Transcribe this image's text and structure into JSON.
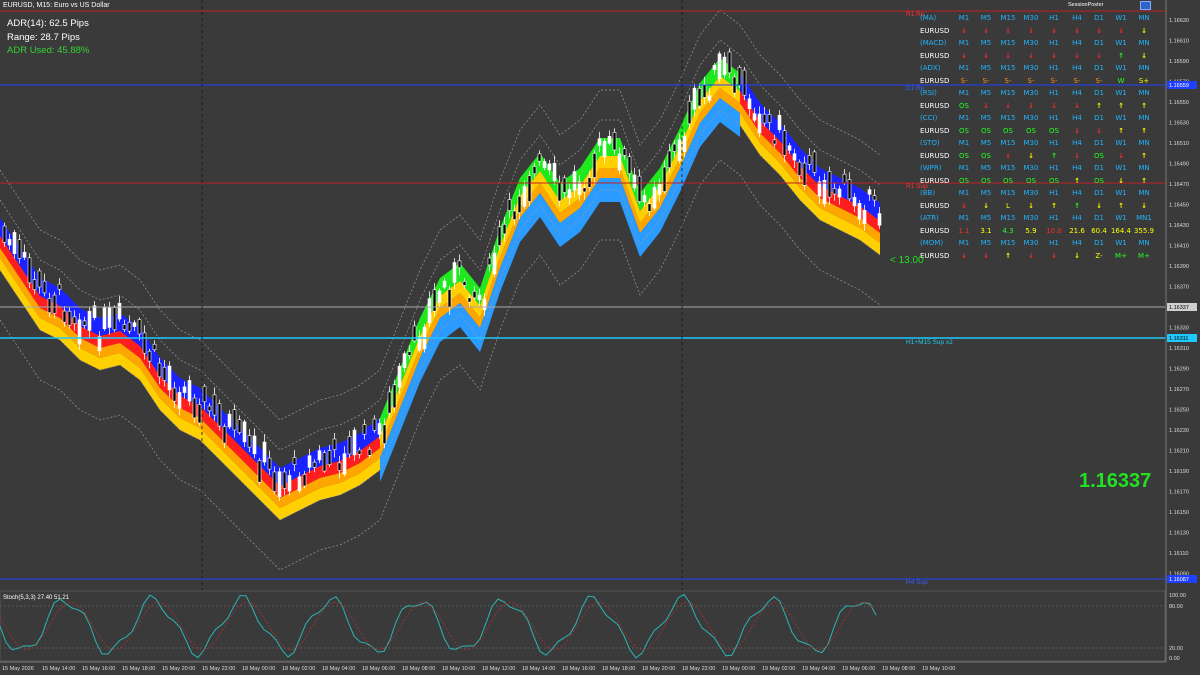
{
  "window": {
    "symbol_label": "EURUSD, M15:  Euro vs US Dollar"
  },
  "adr": {
    "line1": "ADR(14): 62.5 Pips",
    "line2": "Range: 28.7 Pips",
    "line3": "ADR Used: 45.88%"
  },
  "toolbar": {
    "label": "SessionPoster"
  },
  "stoch": {
    "label": "Stoch(5,3,3) 27.40 51.21"
  },
  "price_axis": {
    "ticks": [
      "1.16630",
      "1.16610",
      "1.16590",
      "1.16570",
      "1.16550",
      "1.16530",
      "1.16510",
      "1.16490",
      "1.16470",
      "1.16450",
      "1.16430",
      "1.16410",
      "1.16390",
      "1.16370",
      "1.16350",
      "1.16330",
      "1.16310",
      "1.16290",
      "1.16270",
      "1.16250",
      "1.16230",
      "1.16210",
      "1.16190",
      "1.16170",
      "1.16150",
      "1.16130",
      "1.16110",
      "1.16090"
    ],
    "current_tag": "1.16337",
    "cyan_tag": "1.16311",
    "blue_tag_top": "1.16559",
    "blue_tag_bottom": "1.16087"
  },
  "osc_axis": {
    "top": "100.00",
    "mid": "80.00",
    "low": "20.00",
    "bottom": "0.00"
  },
  "time_axis": {
    "labels": [
      "15 May 2026",
      "15 May 14:00",
      "15 May 16:00",
      "15 May 18:00",
      "15 May 20:00",
      "15 May 22:00",
      "18 May 00:00",
      "18 May 02:00",
      "18 May 04:00",
      "18 May 06:00",
      "18 May 08:00",
      "18 May 10:00",
      "18 May 12:00",
      "18 May 14:00",
      "18 May 16:00",
      "18 May 18:00",
      "18 May 20:00",
      "18 May 22:00",
      "19 May 00:00",
      "19 May 02:00",
      "19 May 04:00",
      "19 May 06:00",
      "19 May 08:00",
      "19 May 10:00"
    ]
  },
  "levels": {
    "top_red": "R1 Re",
    "upper_blue": "D1 Re",
    "mid_red": "R1 Sup",
    "cyan": "H1+M15 Sup x2",
    "bottom_blue": "H4 Sup"
  },
  "dashboard": {
    "columns": [
      "M1",
      "M5",
      "M15",
      "M30",
      "H1",
      "H4",
      "D1",
      "W1",
      "MN"
    ],
    "rows": [
      {
        "label": "(MA)",
        "type": "header"
      },
      {
        "label": "EURUSD",
        "cells": [
          "down",
          "down",
          "down",
          "down",
          "down",
          "down",
          "down",
          "down",
          "down-y"
        ]
      },
      {
        "label": "(MACD)",
        "type": "header"
      },
      {
        "label": "EURUSD",
        "cells": [
          "down",
          "down",
          "down",
          "down",
          "down",
          "down",
          "down",
          "up",
          "down-y"
        ]
      },
      {
        "label": "(ADX)",
        "type": "header"
      },
      {
        "label": "EURUSD",
        "cells": [
          "S-",
          "S-",
          "S-",
          "S-",
          "S-",
          "S-",
          "S-",
          "W",
          "S+"
        ],
        "textcolors": [
          "o",
          "o",
          "o",
          "o",
          "o",
          "o",
          "o",
          "g",
          "y"
        ]
      },
      {
        "label": "(RSI)",
        "type": "header"
      },
      {
        "label": "EURUSD",
        "cells": [
          "OS",
          "down",
          "down",
          "down",
          "down",
          "down",
          "up-y",
          "up-y",
          "up-y"
        ],
        "textcolors": [
          "g"
        ]
      },
      {
        "label": "(CCI)",
        "type": "header"
      },
      {
        "label": "EURUSD",
        "cells": [
          "OS",
          "OS",
          "OS",
          "OS",
          "OS",
          "down",
          "down",
          "up-y",
          "up-y"
        ],
        "textcolors": [
          "g",
          "g",
          "g",
          "g",
          "g"
        ]
      },
      {
        "label": "(STO)",
        "type": "header"
      },
      {
        "label": "EURUSD",
        "cells": [
          "OS",
          "OS",
          "down",
          "down-y",
          "up",
          "down",
          "OS",
          "down",
          "up-y"
        ],
        "textcolors": [
          "g",
          "g",
          "",
          "",
          "",
          "",
          "g"
        ]
      },
      {
        "label": "(WPR)",
        "type": "header"
      },
      {
        "label": "EURUSD",
        "cells": [
          "OS",
          "OS",
          "OS",
          "OS",
          "OS",
          "up-y",
          "OS",
          "down-y",
          "up-y"
        ],
        "textcolors": [
          "g",
          "g",
          "g",
          "g",
          "g",
          "",
          "g"
        ]
      },
      {
        "label": "(BB)",
        "type": "header"
      },
      {
        "label": "EURUSD",
        "cells": [
          "down",
          "down-y",
          "L",
          "down-y",
          "up-y",
          "up",
          "down-y",
          "up-y",
          "down-y"
        ]
      },
      {
        "label": "(ATR)",
        "type": "header",
        "last": "MN1"
      },
      {
        "label": "EURUSD",
        "cells": [
          "1.1",
          "3.1",
          "4.3",
          "5.9",
          "10.0",
          "21.6",
          "60.4",
          "164.4",
          "355.9"
        ],
        "textcolors": [
          "r",
          "y",
          "g",
          "y",
          "r",
          "y",
          "y",
          "y",
          "y"
        ]
      },
      {
        "label": "(MOM)",
        "type": "header"
      },
      {
        "label": "EURUSD",
        "cells": [
          "down",
          "down",
          "up-y",
          "down",
          "down",
          "down-y",
          "Z-",
          "M+",
          "M+"
        ],
        "textcolors": [
          "",
          "",
          "",
          "",
          "",
          "",
          "y",
          "g",
          "g"
        ]
      }
    ]
  },
  "badge": {
    "lt13": "< 13.00"
  },
  "big_price": "1.16337",
  "colors": {
    "bg": "#3a3a3a",
    "ribbon_blue": "#1a22ff",
    "ribbon_red": "#ff1e1e",
    "ribbon_orange": "#ffa500",
    "ribbon_yellow": "#ffd000",
    "ribbon_green": "#1fe81f",
    "ribbon_lightblue": "#2a9bff"
  }
}
